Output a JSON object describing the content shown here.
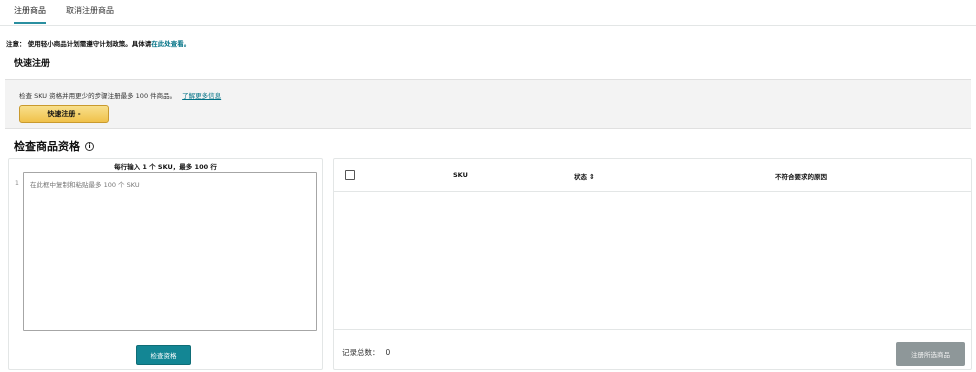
{
  "tabs": [
    {
      "label": "注册商品",
      "active": true
    },
    {
      "label": "取消注册商品",
      "active": false
    }
  ],
  "notice": {
    "text": "注意： 使用轻小商品计划需遵守计划政策。具体请",
    "link": "在此处查看。"
  },
  "quick_register": {
    "title": "快速注册",
    "description": "检查 SKU 资格并用更少的步骤注册最多 100 件商品。",
    "learn_more": "了解更多信息",
    "button_label": "快速注册 -"
  },
  "check_eligibility": {
    "title": "检查商品资格",
    "info_icon": "i",
    "hint": "每行输入 1 个 SKU，最多 100 行",
    "line_number": "1",
    "textarea_placeholder": "在此框中复制和粘贴最多 100 个 SKU",
    "check_button": "检查资格"
  },
  "table": {
    "columns": {
      "sku": "SKU",
      "status": "状态",
      "reason": "不符合要求的原因"
    },
    "sort_icon": "⇕",
    "count_label": "记录总数：",
    "count_value": "0",
    "register_button": "注册所选商品"
  },
  "colors": {
    "accent": "#138694",
    "link": "#007185",
    "quick_button": "#f0c14b",
    "disabled_button": "#8e9799"
  }
}
